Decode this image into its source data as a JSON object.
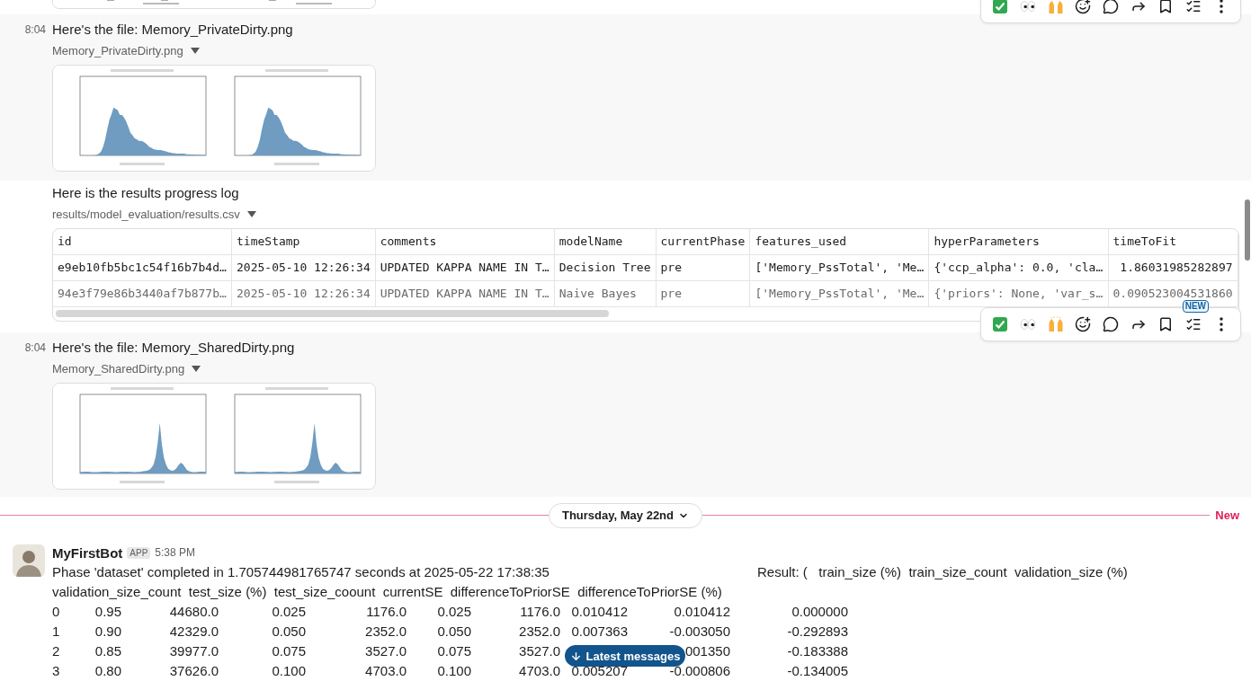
{
  "messages": [
    {
      "kind": "file",
      "time": "8:04",
      "hovered": true,
      "text": "Here's the file: Memory_PrivateDirty.png",
      "file_name": "Memory_PrivateDirty.png"
    },
    {
      "kind": "table",
      "hovered": false,
      "text": "Here is the results progress log",
      "file_name": "results/model_evaluation/results.csv",
      "table": {
        "columns": [
          "id",
          "timeStamp",
          "comments",
          "modelName",
          "currentPhase",
          "features_used",
          "hyperParameters",
          "timeToFit"
        ],
        "rows": [
          {
            "muted": false,
            "cells": [
              "e9eb10fb5bc1c54f16b7b4d…",
              "2025-05-10 12:26:34",
              "UPDATED KAPPA NAME IN T…",
              "Decision Tree",
              "pre",
              "['Memory_PssTotal', 'Me…",
              "{'ccp_alpha': 0.0, 'cla…",
              " 1.86031985282897"
            ]
          },
          {
            "muted": true,
            "cells": [
              "94e3f79e86b3440af7b877b…",
              "2025-05-10 12:26:34",
              "UPDATED KAPPA NAME IN T…",
              "Naive Bayes",
              "pre",
              "['Memory_PssTotal', 'Me…",
              "{'priors': None, 'var_s…",
              "0.090523004531860"
            ]
          }
        ]
      }
    },
    {
      "kind": "file",
      "time": "8:04",
      "hovered": true,
      "toolbar_badge": "NEW",
      "text": "Here's the file: Memory_SharedDirty.png",
      "file_name": "Memory_SharedDirty.png"
    }
  ],
  "divider": {
    "label": "Thursday, May 22nd",
    "new_label": "New"
  },
  "bot_message": {
    "name": "MyFirstBot",
    "badge": "APP",
    "time": "5:38 PM",
    "summary": "Phase 'dataset' completed in 1.705744981765747 seconds at 2025-05-22 17:38:35",
    "result_header": "Result: (   train_size (%)  train_size_count  validation_size (%)",
    "header": "validation_size_count  test_size (%)  test_size_coount  currentSE  differenceToPriorSE  differenceToPriorSE (%)",
    "rows": [
      [
        "0",
        "0.95",
        "44680.0",
        "0.025",
        "1176.0",
        "0.025",
        "1176.0",
        "0.010412",
        "0.010412",
        "0.000000"
      ],
      [
        "1",
        "0.90",
        "42329.0",
        "0.050",
        "2352.0",
        "0.050",
        "2352.0",
        "0.007363",
        "-0.003050",
        "-0.292893"
      ],
      [
        "2",
        "0.85",
        "39977.0",
        "0.075",
        "3527.0",
        "0.075",
        "3527.0",
        null,
        "001350",
        "-0.183388"
      ],
      [
        "3",
        "0.80",
        "37626.0",
        "0.100",
        "4703.0",
        "0.100",
        "4703.0",
        "0.005207",
        "-0.000806",
        "-0.134005"
      ]
    ]
  },
  "jump_button": {
    "label": "Latest messages"
  }
}
